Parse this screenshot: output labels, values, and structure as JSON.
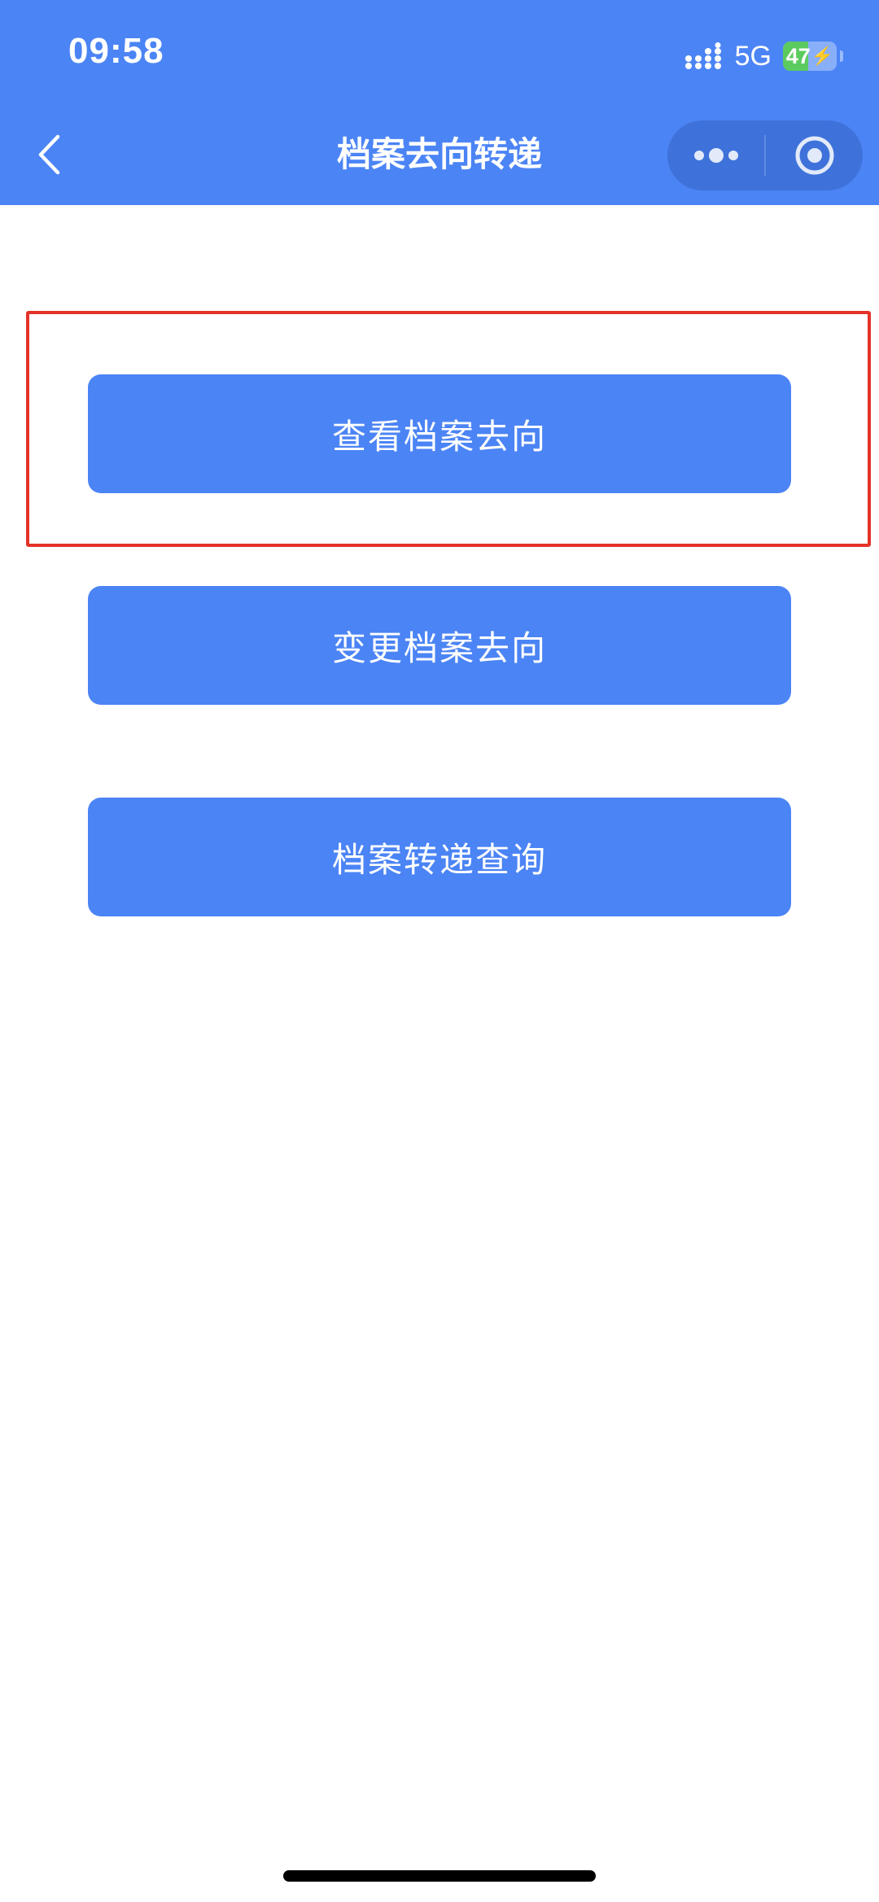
{
  "status_bar": {
    "time": "09:58",
    "network": "5G",
    "battery_percent": "47",
    "battery_level": 0.47,
    "charging_symbol": "⚡"
  },
  "nav_bar": {
    "title": "档案去向转递",
    "back_icon": "chevron-left-icon",
    "more_icon": "more-dots-icon",
    "close_icon": "target-circle-icon"
  },
  "buttons": {
    "view_destination": "查看档案去向",
    "change_destination": "变更档案去向",
    "transfer_query": "档案转递查询"
  },
  "colors": {
    "primary_blue": "#4b84f5",
    "highlight_red": "#e53228",
    "battery_green": "#5ccb5f"
  }
}
